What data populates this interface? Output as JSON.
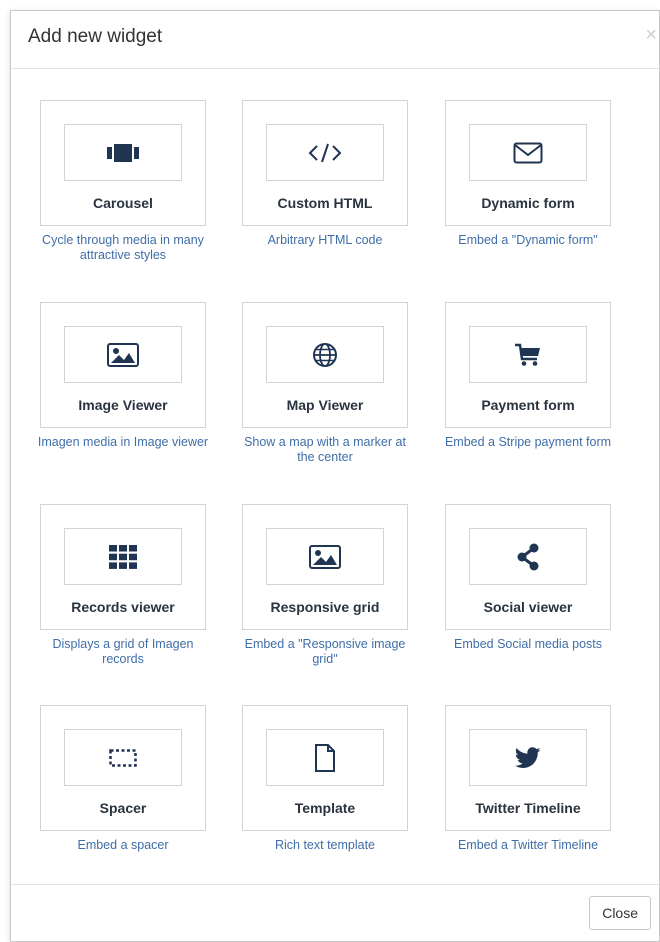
{
  "modal": {
    "title": "Add new widget",
    "close_x": "×",
    "close_button": "Close"
  },
  "widgets": [
    {
      "label": "Carousel",
      "description": "Cycle through media in many attractive styles",
      "icon": "carousel-icon"
    },
    {
      "label": "Custom HTML",
      "description": "Arbitrary HTML code",
      "icon": "code-icon"
    },
    {
      "label": "Dynamic form",
      "description": "Embed a \"Dynamic form\"",
      "icon": "envelope-icon"
    },
    {
      "label": "Image Viewer",
      "description": "Imagen media in Image viewer",
      "icon": "image-icon"
    },
    {
      "label": "Map Viewer",
      "description": "Show a map with a marker at the center",
      "icon": "globe-icon"
    },
    {
      "label": "Payment form",
      "description": "Embed a Stripe payment form",
      "icon": "cart-icon"
    },
    {
      "label": "Records viewer",
      "description": "Displays a grid of Imagen records",
      "icon": "grid-icon"
    },
    {
      "label": "Responsive grid",
      "description": "Embed a \"Responsive image grid\"",
      "icon": "image-icon"
    },
    {
      "label": "Social viewer",
      "description": "Embed Social media posts",
      "icon": "share-icon"
    },
    {
      "label": "Spacer",
      "description": "Embed a spacer",
      "icon": "spacer-icon"
    },
    {
      "label": "Template",
      "description": "Rich text template",
      "icon": "file-icon"
    },
    {
      "label": "Twitter Timeline",
      "description": "Embed a Twitter Timeline",
      "icon": "twitter-icon"
    }
  ],
  "colors": {
    "icon": "#1f3552",
    "description": "#3f6ea8",
    "border": "#d4d4d4"
  }
}
